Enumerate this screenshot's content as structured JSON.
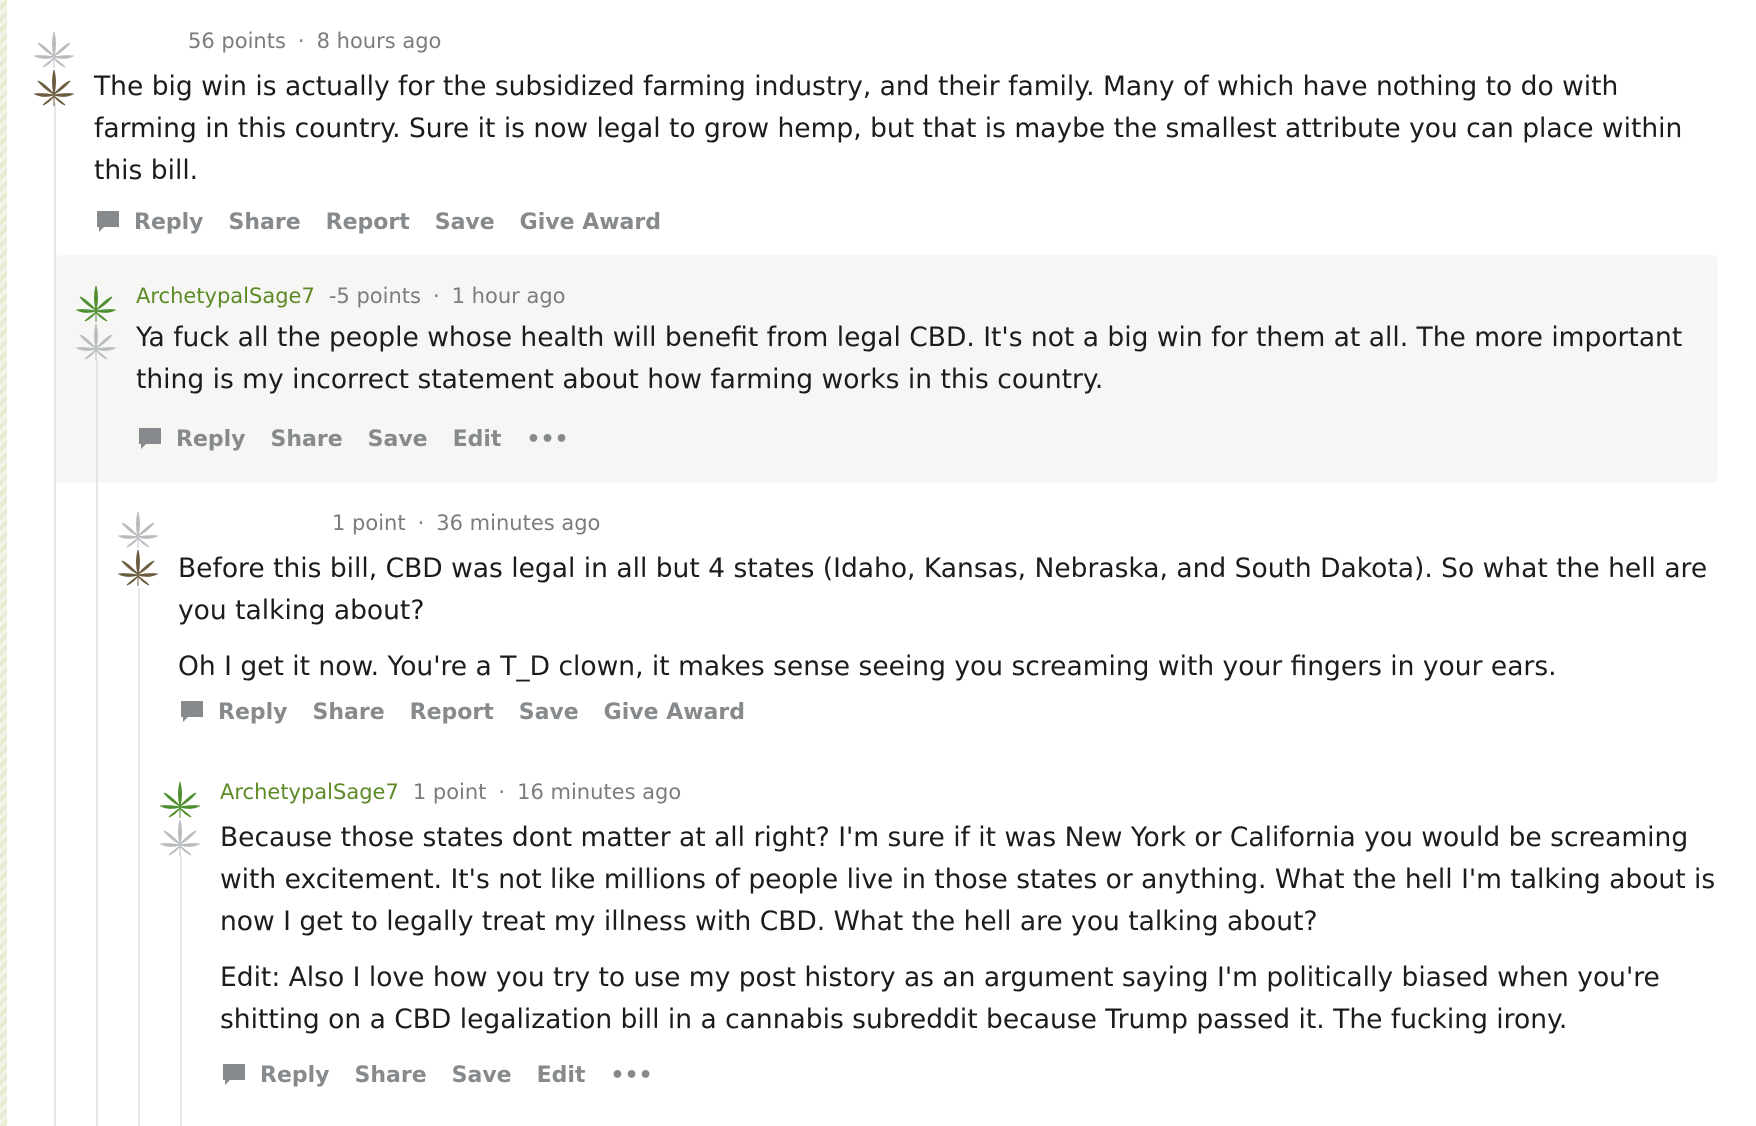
{
  "colors": {
    "author_green": "#5d8a26",
    "muted_text": "#7c7c7c",
    "action_gray": "#878a8c",
    "highlight_bg": "#f6f7f4",
    "leaf_brown": "#6b5d3f",
    "leaf_green": "#4f8f2f",
    "leaf_gray": "#b9bcbf"
  },
  "icons": {
    "upvote": "gray-leaf-icon",
    "downvote_brown": "brown-leaf-icon",
    "upvote_green": "green-leaf-icon",
    "reply": "speech-bubble-icon",
    "more": "ellipsis-icon"
  },
  "comments": [
    {
      "author": "",
      "points": "56 points",
      "separator": "·",
      "time": "8 hours ago",
      "paragraphs": [
        "The big win is actually for the subsidized farming industry, and their family. Many of which have nothing to do with farming in this country. Sure it is now legal to grow hemp, but that is maybe the smallest attribute you can place within this bill."
      ],
      "actions": [
        "Reply",
        "Share",
        "Report",
        "Save",
        "Give Award"
      ]
    },
    {
      "author": "ArchetypalSage7",
      "points": "-5 points",
      "separator": "·",
      "time": "1 hour ago",
      "paragraphs": [
        "Ya fuck all the people whose health will benefit from legal CBD. It's not a big win for them at all. The more important thing is my incorrect statement about how farming works in this country."
      ],
      "actions": [
        "Reply",
        "Share",
        "Save",
        "Edit",
        "•••"
      ]
    },
    {
      "author": "",
      "points": "1 point",
      "separator": "·",
      "time": "36 minutes ago",
      "paragraphs": [
        "Before this bill, CBD was legal in all but 4 states (Idaho, Kansas, Nebraska, and South Dakota). So what the hell are you talking about?",
        "Oh I get it now. You're a T_D clown, it makes sense seeing you screaming with your fingers in your ears."
      ],
      "actions": [
        "Reply",
        "Share",
        "Report",
        "Save",
        "Give Award"
      ]
    },
    {
      "author": "ArchetypalSage7",
      "points": "1 point",
      "separator": "·",
      "time": "16 minutes ago",
      "paragraphs": [
        "Because those states dont matter at all right? I'm sure if it was New York or California you would be screaming with excitement. It's not like millions of people live in those states or anything. What the hell I'm talking about is now I get to legally treat my illness with CBD. What the hell are you talking about?",
        "Edit: Also I love how you try to use my post history as an argument saying I'm politically biased when you're shitting on a CBD legalization bill in a cannabis subreddit because Trump passed it. The fucking irony."
      ],
      "actions": [
        "Reply",
        "Share",
        "Save",
        "Edit",
        "•••"
      ]
    }
  ]
}
